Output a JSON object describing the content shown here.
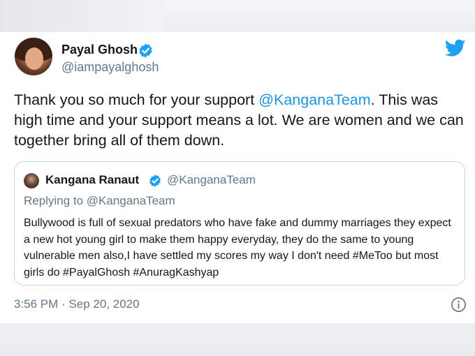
{
  "tweet": {
    "author": {
      "name": "Payal Ghosh",
      "handle": "@iampayalghosh",
      "verified": true,
      "avatar": "profile-photo"
    },
    "text_before": "Thank you so much for your support ",
    "mention": "@KanganaTeam",
    "text_after": ". This was high time and your support means a lot. We are women and we can together bring all of them down.",
    "timestamp": "3:56 PM · Sep 20, 2020",
    "logo_icon": "twitter-bird-icon",
    "info_icon": "info-icon"
  },
  "quoted_tweet": {
    "author": {
      "name": "Kangana Ranaut",
      "handle": "@KanganaTeam",
      "verified": true,
      "avatar": "profile-photo"
    },
    "replying_to": "Replying to @KanganaTeam",
    "text": "Bullywood is full of sexual predators who have fake and dummy marriages they expect a new hot young girl to make them happy everyday, they do the same to young vulnerable men also,I have settled my scores my way I don't need #MeToo but most girls do #PayalGhosh #AnuragKashyap"
  },
  "colors": {
    "accent": "#1da1f2",
    "link": "#1b95e0",
    "secondary_text": "#657786",
    "border": "#ccd6dd"
  }
}
